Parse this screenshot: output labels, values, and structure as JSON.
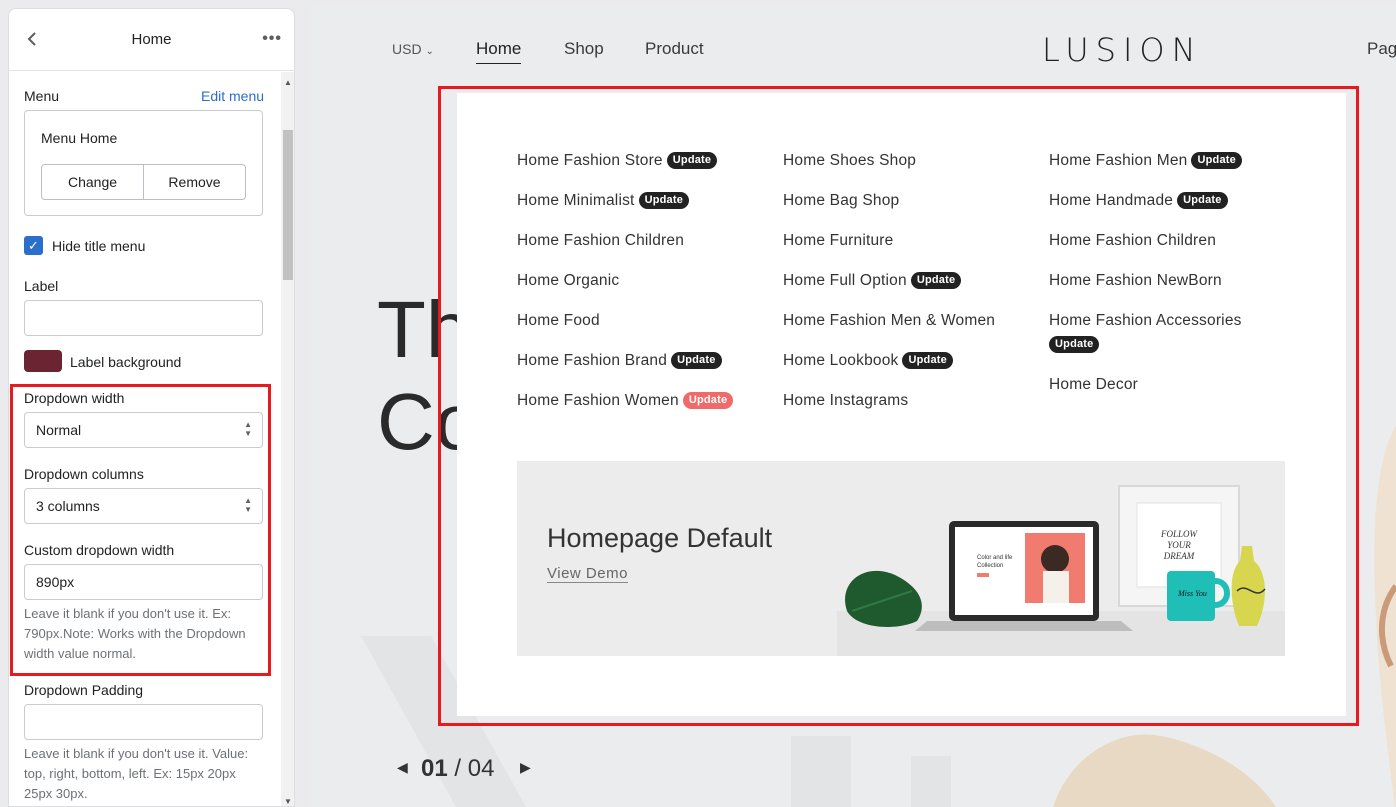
{
  "sidebar": {
    "title": "Home",
    "back_icon": "chevron-left-icon",
    "more_icon": "ellipsis-icon",
    "menu_label": "Menu",
    "edit_menu_link": "Edit menu",
    "menu_card": {
      "name": "Menu Home",
      "change_label": "Change",
      "remove_label": "Remove"
    },
    "hide_title_menu": {
      "label": "Hide title menu",
      "checked": true
    },
    "label_field": {
      "label": "Label",
      "value": ""
    },
    "label_background": {
      "label": "Label background",
      "color": "#6b2532"
    },
    "dropdown_width": {
      "label": "Dropdown width",
      "value": "Normal"
    },
    "dropdown_columns": {
      "label": "Dropdown columns",
      "value": "3 columns"
    },
    "custom_dropdown_width": {
      "label": "Custom dropdown width",
      "value": "890px",
      "help": "Leave it blank if you don't use it. Ex: 790px.Note: Works with the Dropdown width value normal."
    },
    "dropdown_padding": {
      "label": "Dropdown Padding",
      "value": "",
      "help": "Leave it blank if you don't use it. Value: top, right, bottom, left. Ex: 15px 20px 25px 30px."
    }
  },
  "store": {
    "currency": "USD",
    "nav": [
      "Home",
      "Shop",
      "Product"
    ],
    "nav_right_partial": "Pag",
    "logo": "LUSION",
    "hero_line1": "Th",
    "hero_line2": "Co",
    "slide_current": "01",
    "slide_sep": "/",
    "slide_total": "04",
    "badge_label": "Update",
    "columns": [
      [
        {
          "label": "Home Fashion Store",
          "badge": "dark"
        },
        {
          "label": "Home Minimalist",
          "badge": "dark"
        },
        {
          "label": "Home Fashion Children",
          "badge": null
        },
        {
          "label": "Home Organic",
          "badge": null
        },
        {
          "label": "Home Food",
          "badge": null
        },
        {
          "label": "Home Fashion Brand",
          "badge": "dark"
        },
        {
          "label": "Home Fashion Women",
          "badge": "red"
        }
      ],
      [
        {
          "label": "Home Shoes Shop",
          "badge": null
        },
        {
          "label": "Home Bag Shop",
          "badge": null
        },
        {
          "label": "Home Furniture",
          "badge": null
        },
        {
          "label": "Home Full Option",
          "badge": "dark"
        },
        {
          "label": "Home Fashion Men & Women",
          "badge": null
        },
        {
          "label": "Home Lookbook",
          "badge": "dark"
        },
        {
          "label": "Home Instagrams",
          "badge": null
        }
      ],
      [
        {
          "label": "Home Fashion Men",
          "badge": "dark"
        },
        {
          "label": "Home Handmade",
          "badge": "dark"
        },
        {
          "label": "Home Fashion Children",
          "badge": null
        },
        {
          "label": "Home Fashion NewBorn",
          "badge": null
        },
        {
          "label": "Home Fashion Accessories",
          "badge": "dark",
          "wrap": true
        },
        {
          "label": "Home Decor",
          "badge": null
        }
      ]
    ],
    "banner": {
      "title": "Homepage Default",
      "link": "View Demo",
      "laptop_text": "Color and life Collection",
      "frame_text": "FOLLOW YOUR DREAM",
      "mug_text": "Miss You"
    }
  },
  "colors": {
    "highlight": "#e8191f",
    "accent": "#2c6ecb",
    "badge_dark": "#222222",
    "badge_red": "#f06a6a"
  }
}
